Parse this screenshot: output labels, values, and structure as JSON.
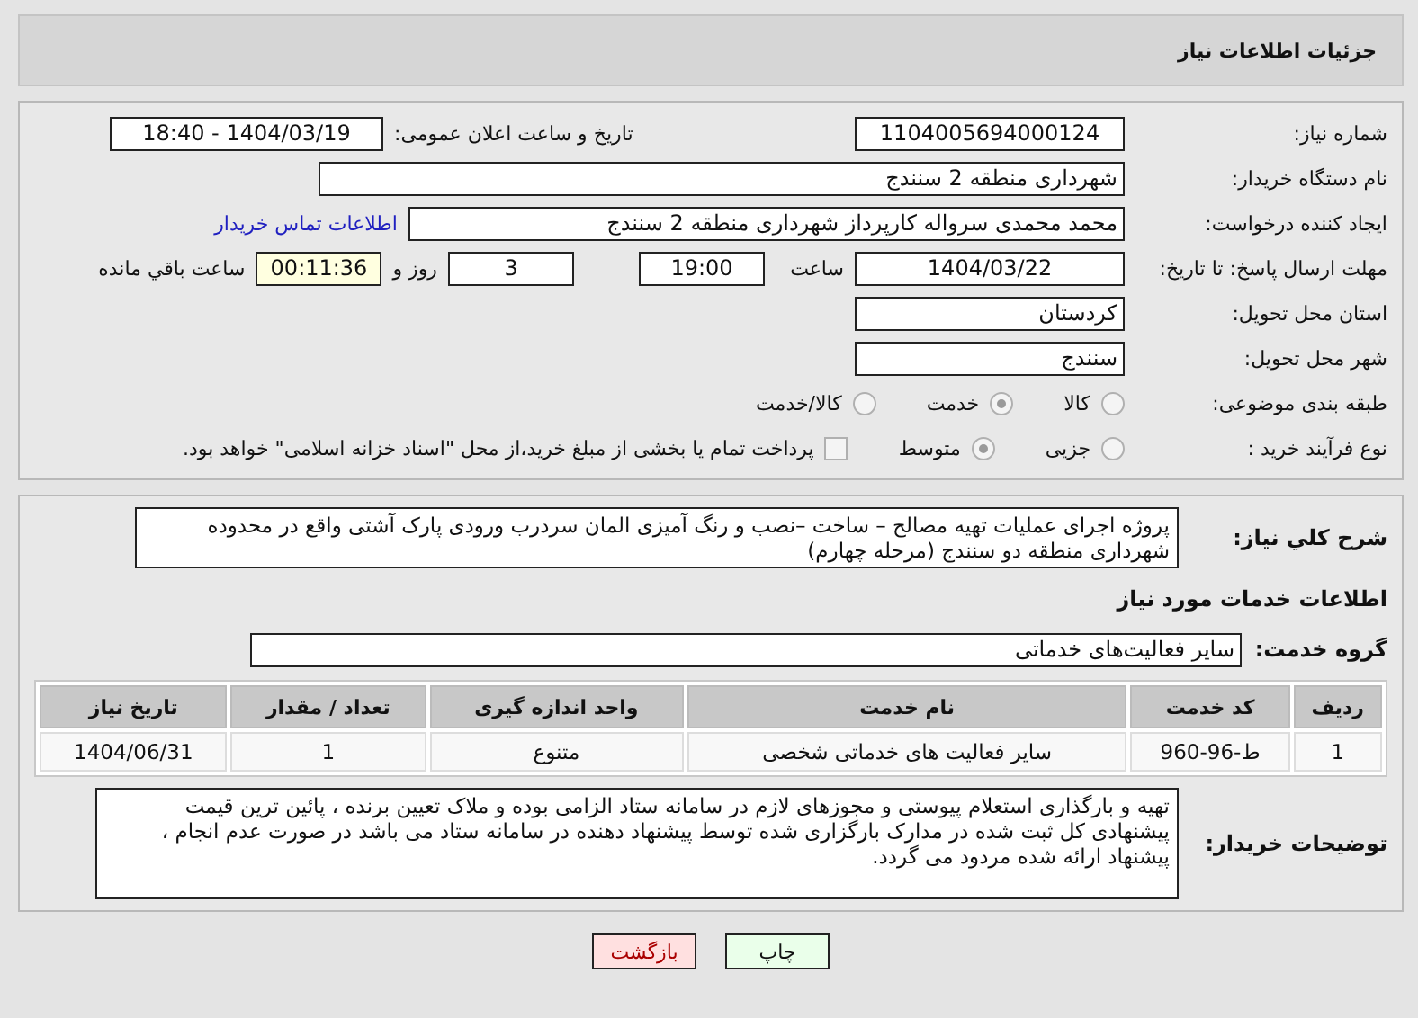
{
  "header": {
    "title": "جزئیات اطلاعات نیاز"
  },
  "need_number": {
    "label": "شماره نیاز:",
    "value": "1104005694000124"
  },
  "announce": {
    "label": "تاریخ و ساعت اعلان عمومی:",
    "value": "1404/03/19 - 18:40"
  },
  "buyer_org": {
    "label": "نام دستگاه خریدار:",
    "value": "شهرداری منطقه 2 سنندج"
  },
  "requester": {
    "label": "ایجاد کننده درخواست:",
    "value": "محمد محمدی سرواله کارپرداز شهرداری منطقه 2 سنندج",
    "link": "اطلاعات تماس خریدار"
  },
  "deadline": {
    "label": "مهلت ارسال پاسخ: تا تاریخ:",
    "date": "1404/03/22",
    "time_label": "ساعت",
    "time": "19:00",
    "days": "3",
    "days_label": "روز و",
    "remaining": "00:11:36",
    "remaining_label": "ساعت باقي مانده"
  },
  "province": {
    "label": "استان محل تحویل:",
    "value": "کردستان"
  },
  "city": {
    "label": "شهر محل تحویل:",
    "value": "سنندج"
  },
  "category": {
    "label": "طبقه بندی موضوعی:",
    "options": [
      {
        "label": "کالا",
        "selected": false
      },
      {
        "label": "خدمت",
        "selected": true
      },
      {
        "label": "کالا/خدمت",
        "selected": false
      }
    ]
  },
  "purchase_type": {
    "label": "نوع فرآیند خرید :",
    "options": [
      {
        "label": "جزیی",
        "selected": false
      },
      {
        "label": "متوسط",
        "selected": true
      }
    ],
    "payment": {
      "label": "پرداخت تمام یا بخشی از مبلغ خرید،از محل \"اسناد خزانه اسلامی\" خواهد بود.",
      "checked": false
    }
  },
  "description": {
    "label": "شرح کلي نياز:",
    "value": "پروژه اجرای عملیات تهیه مصالح – ساخت –نصب و رنگ آمیزی  المان سردرب ورودی پارک آشتی واقع در محدوده شهرداری منطقه دو سنندج (مرحله چهارم)"
  },
  "services_heading": "اطلاعات خدمات مورد نیاز",
  "service_group": {
    "label": "گروه خدمت:",
    "value": "سایر فعالیت‌های خدماتی"
  },
  "table": {
    "columns": [
      "ردیف",
      "کد خدمت",
      "نام خدمت",
      "واحد اندازه گیری",
      "تعداد / مقدار",
      "تاریخ نیاز"
    ],
    "rows": [
      [
        "1",
        "ط-96-960",
        "سایر فعالیت های خدماتی شخصی",
        "متنوع",
        "1",
        "1404/06/31"
      ]
    ]
  },
  "buyer_notes": {
    "label": "توضیحات خریدار:",
    "value": "تهیه و بارگذاری استعلام پیوستی و مجوزهای لازم در سامانه ستاد الزامی بوده و ملاک تعیین برنده ، پائین ترین قیمت پیشنهادی کل ثبت شده در مدارک بارگزاری شده توسط پیشنهاد دهنده در سامانه ستاد می باشد در صورت عدم انجام ، پیشنهاد ارائه شده مردود می گردد."
  },
  "buttons": [
    {
      "label": "چاپ",
      "kind": "print"
    },
    {
      "label": "بازگشت",
      "kind": "back"
    }
  ]
}
